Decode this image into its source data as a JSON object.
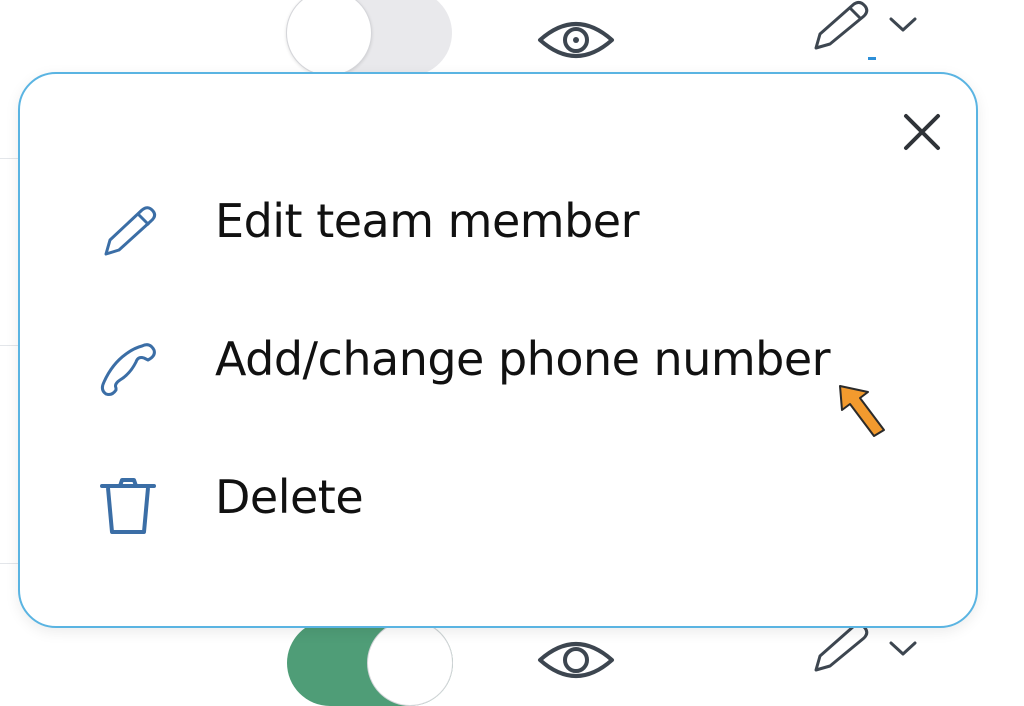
{
  "colors": {
    "popup_border": "#5ab4e2",
    "icon_blue": "#3b6ea6",
    "toggle_on": "#4f9d77",
    "toggle_off": "#e9e9ec",
    "cursor": "#f29a2e"
  },
  "background": {
    "rows": [
      {
        "toggle_state": "off",
        "view_icon": "eye-icon",
        "edit_icon": "pencil-icon",
        "dropdown_icon": "chevron-down-icon"
      },
      {
        "toggle_state": "on",
        "view_icon": "eye-icon",
        "edit_icon": "pencil-icon",
        "dropdown_icon": "chevron-down-icon"
      }
    ]
  },
  "popup": {
    "close_icon": "close-icon",
    "items": [
      {
        "label": "Edit team member",
        "icon": "pencil-icon"
      },
      {
        "label": "Add/change phone number",
        "icon": "phone-icon"
      },
      {
        "label": "Delete",
        "icon": "trash-icon"
      }
    ]
  },
  "pointer": {
    "icon": "cursor-arrow-icon"
  }
}
